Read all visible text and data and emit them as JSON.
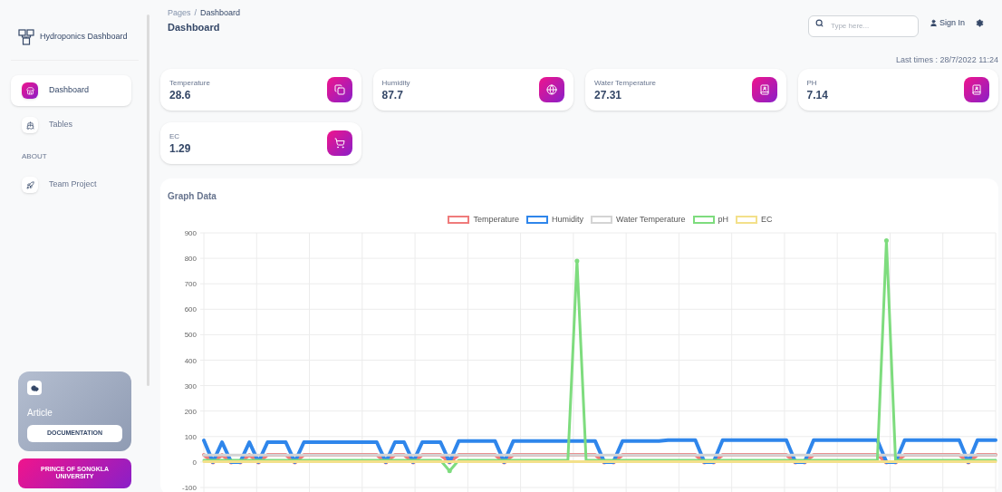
{
  "sidebar": {
    "brand": "Hydroponics Dashboard",
    "items": [
      {
        "label": "Dashboard",
        "selected": true
      },
      {
        "label": "Tables",
        "selected": false
      },
      {
        "kind": "heading",
        "label": "ABOUT"
      },
      {
        "label": "Team Project",
        "selected": false
      }
    ],
    "article": {
      "title": "Article",
      "button": "DOCUMENTATION"
    },
    "university_button": "PRINCE OF SONGKLA UNIVERSITY"
  },
  "breadcrumb": {
    "parent": "Pages",
    "separator": "/",
    "current": "Dashboard"
  },
  "page_title": "Dashboard",
  "search": {
    "placeholder": "Type here..."
  },
  "sign_in": "Sign In",
  "last_times": "Last times : 28/7/2022 11:24",
  "stats": [
    {
      "label": "Temperature",
      "value": "28.6"
    },
    {
      "label": "Humidity",
      "value": "87.7"
    },
    {
      "label": "Water Temperature",
      "value": "27.31"
    },
    {
      "label": "PH",
      "value": "7.14"
    },
    {
      "label": "EC",
      "value": "1.29"
    }
  ],
  "graph": {
    "title": "Graph Data",
    "chart_data": {
      "type": "line",
      "grid": true,
      "ylim": [
        -100,
        900
      ],
      "yticks": [
        900,
        800,
        700,
        600,
        500,
        400,
        300,
        200,
        100,
        0,
        -100
      ],
      "series": [
        {
          "name": "Temperature",
          "color": "#ef7b7b",
          "values": [
            28,
            0,
            28,
            0,
            0,
            28,
            0,
            28,
            28,
            28,
            0,
            28,
            28,
            28,
            28,
            28,
            28,
            28,
            28,
            28,
            0,
            28,
            28,
            0,
            28,
            28,
            28,
            0,
            28,
            28,
            28,
            28,
            28,
            0,
            28,
            28,
            28,
            28,
            28,
            28,
            28,
            28,
            28,
            28,
            0,
            0,
            28,
            28,
            28,
            28,
            28,
            28,
            28,
            28,
            28,
            0,
            0,
            28,
            28,
            28,
            28,
            28,
            28,
            28,
            28,
            0,
            0,
            28,
            28,
            28,
            28,
            28,
            28,
            28,
            28,
            0,
            0,
            28,
            28,
            28,
            28,
            28,
            28,
            28,
            0,
            28,
            28,
            28
          ]
        },
        {
          "name": "Humidity",
          "color": "#2f86eb",
          "values": [
            85,
            0,
            78,
            0,
            0,
            78,
            0,
            78,
            78,
            78,
            0,
            78,
            78,
            78,
            78,
            78,
            78,
            78,
            78,
            78,
            0,
            78,
            78,
            0,
            78,
            78,
            78,
            0,
            82,
            82,
            82,
            82,
            82,
            0,
            82,
            82,
            82,
            82,
            82,
            82,
            82,
            82,
            82,
            82,
            0,
            0,
            82,
            82,
            82,
            82,
            82,
            86,
            86,
            86,
            86,
            0,
            0,
            86,
            86,
            86,
            86,
            86,
            86,
            86,
            86,
            0,
            0,
            86,
            86,
            86,
            86,
            86,
            86,
            86,
            86,
            0,
            0,
            86,
            86,
            86,
            86,
            86,
            86,
            86,
            0,
            86,
            86,
            86
          ]
        },
        {
          "name": "Water Temperature",
          "color": "#d4d4d4",
          "values": [
            27,
            27,
            27,
            27,
            27,
            27,
            27,
            27,
            27,
            27,
            27,
            27,
            27,
            27,
            27,
            27,
            27,
            27,
            27,
            27,
            27,
            27,
            27,
            27,
            27,
            27,
            27,
            27,
            27,
            27,
            27,
            27,
            27,
            27,
            27,
            27,
            27,
            27,
            27,
            27,
            27,
            27,
            27,
            27,
            27,
            27,
            27,
            27,
            27,
            27,
            27,
            27,
            27,
            27,
            27,
            27,
            27,
            27,
            27,
            27,
            27,
            27,
            27,
            27,
            27,
            27,
            27,
            27,
            27,
            27,
            27,
            27,
            27,
            27,
            27,
            27,
            27,
            27,
            27,
            27,
            27,
            27,
            27,
            27,
            27,
            27,
            27,
            27
          ]
        },
        {
          "name": "pH",
          "color": "#7edc7e",
          "values": [
            7,
            7,
            7,
            7,
            7,
            7,
            7,
            7,
            7,
            7,
            7,
            7,
            7,
            7,
            7,
            7,
            7,
            7,
            7,
            7,
            7,
            7,
            7,
            7,
            7,
            7,
            7,
            -35,
            7,
            7,
            7,
            7,
            7,
            7,
            7,
            7,
            7,
            7,
            7,
            7,
            7,
            790,
            7,
            7,
            7,
            7,
            7,
            7,
            7,
            7,
            7,
            7,
            7,
            7,
            7,
            7,
            7,
            7,
            7,
            7,
            7,
            7,
            7,
            7,
            7,
            7,
            7,
            7,
            7,
            7,
            7,
            7,
            7,
            7,
            7,
            870,
            7,
            7,
            7,
            7,
            7,
            7,
            7,
            7,
            7,
            7,
            7,
            7
          ]
        },
        {
          "name": "EC",
          "color": "#f3e08a",
          "values": [
            1,
            1,
            1,
            1,
            1,
            1,
            1,
            1,
            1,
            1,
            1,
            1,
            1,
            1,
            1,
            1,
            1,
            1,
            1,
            1,
            1,
            1,
            1,
            1,
            1,
            1,
            1,
            1,
            1,
            1,
            1,
            1,
            1,
            1,
            1,
            1,
            1,
            1,
            1,
            1,
            1,
            1,
            1,
            1,
            1,
            1,
            1,
            1,
            1,
            1,
            1,
            1,
            1,
            1,
            1,
            1,
            1,
            1,
            1,
            1,
            1,
            1,
            1,
            1,
            1,
            1,
            1,
            1,
            1,
            1,
            1,
            1,
            1,
            1,
            1,
            1,
            1,
            1,
            1,
            1,
            1,
            1,
            1,
            1,
            1,
            1,
            1,
            1
          ]
        }
      ]
    }
  }
}
